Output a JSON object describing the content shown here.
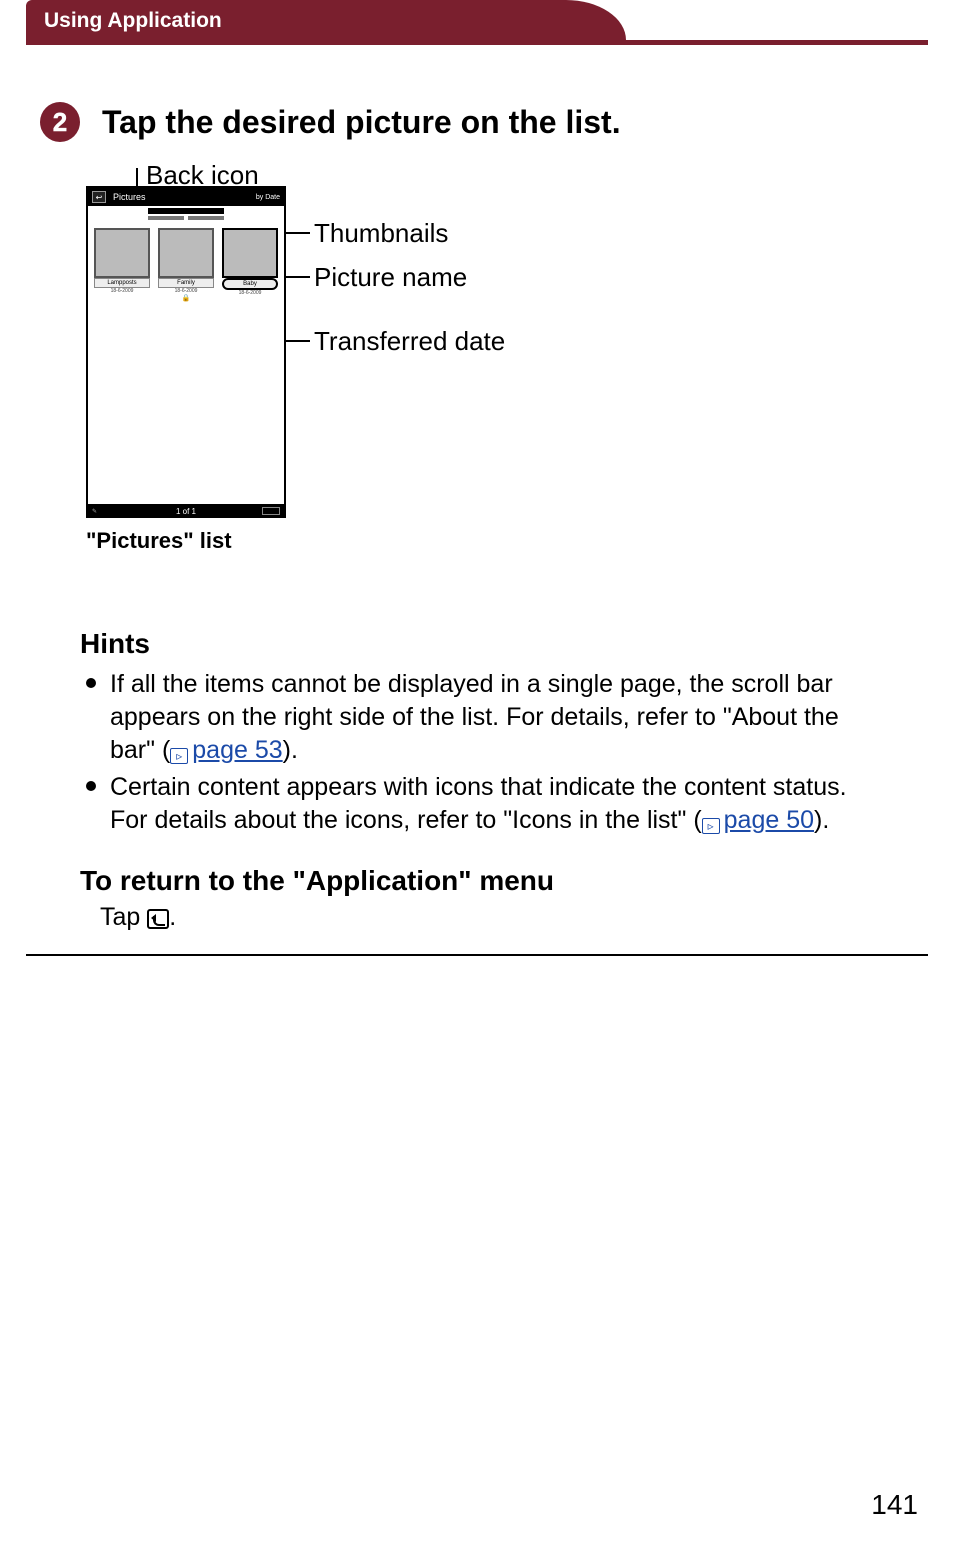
{
  "header": {
    "section": "Using Application"
  },
  "step": {
    "number": "2",
    "title": "Tap the desired picture on the list."
  },
  "callouts": {
    "back_icon": "Back icon",
    "thumbnails": "Thumbnails",
    "picture_name": "Picture name",
    "transferred_date": "Transferred date"
  },
  "device": {
    "title": "Pictures",
    "sort": "by Date",
    "pager": "1 of 1",
    "thumbs": [
      {
        "name": "Lampposts",
        "date": "18-6-2009"
      },
      {
        "name": "Family",
        "date": "18-6-2009",
        "locked": true
      },
      {
        "name": "Baby",
        "date": "18-6-2009"
      }
    ]
  },
  "figure_caption": "\"Pictures\" list",
  "hints": {
    "heading": "Hints",
    "items": [
      {
        "pre": "If all the items cannot be displayed in a single page,  the scroll bar appears on the right side of the list. For details, refer to \"About the bar\" (",
        "link": "page 53",
        "post": ")."
      },
      {
        "pre": "Certain content appears with icons that indicate the content status. For details about the icons, refer to \"Icons in the list\" (",
        "link": "page 50",
        "post": ")."
      }
    ]
  },
  "return_section": {
    "heading": "To return to the \"Application\" menu",
    "text_pre": "Tap ",
    "text_post": "."
  },
  "page_number": "141"
}
